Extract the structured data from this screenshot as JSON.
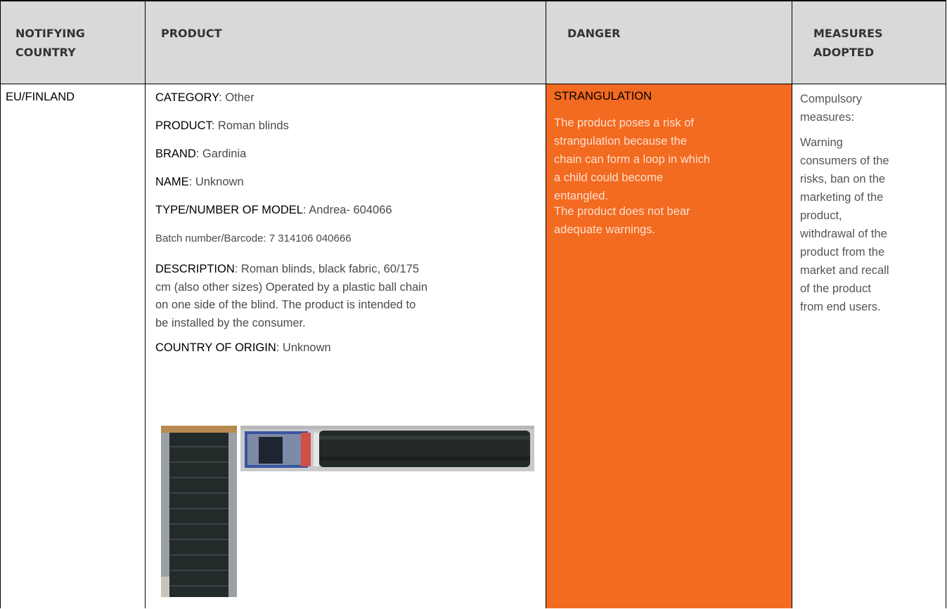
{
  "header": {
    "col1_line1": "NOTIFYING",
    "col1_line2": "COUNTRY",
    "col2": "PRODUCT",
    "col3": "DANGER",
    "col4_line1": "MEASURES",
    "col4_line2": "ADOPTED"
  },
  "row": {
    "country": "EU/FINLAND",
    "category_label": "CATEGORY",
    "category_value": ": Other",
    "product_label": "PRODUCT",
    "product_value": ": Roman blinds",
    "brand_label": "BRAND",
    "brand_value": ": Gardinia",
    "name_label": "NAME",
    "name_value": ": Unknown",
    "model_label": "TYPE/NUMBER OF MODEL",
    "model_value": ": Andrea- 604066",
    "batch": "Batch number/Barcode: 7 314106 040666",
    "description_label": "DESCRIPTION",
    "description_line1": ": Roman blinds, black fabric, 60/175",
    "description_line2": "cm (also other sizes) Operated by a plastic ball chain",
    "description_line3": "on one side of the blind. The product is intended to",
    "description_line4": "be installed by the consumer.",
    "origin_label": "COUNTRY OF ORIGIN",
    "origin_value": ": Unknown",
    "danger_title": "STRANGULATION",
    "danger_line1": "The product poses a risk of",
    "danger_line2": "strangulation because the",
    "danger_line3": "chain can form a loop in which",
    "danger_line4": "a child could become",
    "danger_line5": "entangled.",
    "danger_line6": "The product does not bear",
    "danger_line7": "adequate warnings.",
    "measures_line1": "Compulsory",
    "measures_line2": "measures:",
    "measures_line3": "Warning",
    "measures_line4": "consumers of the",
    "measures_line5": "risks, ban on the",
    "measures_line6": "marketing of the",
    "measures_line7": "product,",
    "measures_line8": "withdrawal of the",
    "measures_line9": "product from the",
    "measures_line10": "market and recall",
    "measures_line11": "of the product",
    "measures_line12": "from end users."
  },
  "colors": {
    "header_bg": "#d9d9d9",
    "danger_bg": "#f36a21",
    "danger_text": "#fde0cc"
  }
}
